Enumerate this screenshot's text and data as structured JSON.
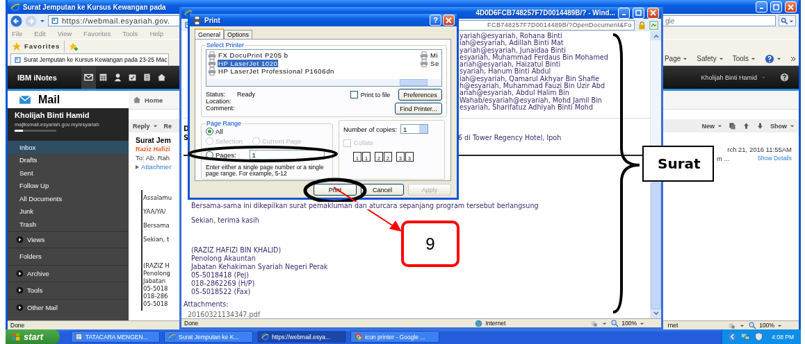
{
  "background_window": {
    "title": "Surat Jemputan ke Kursus Kewangan pada",
    "address": "https://webmail.esyariah.gov.",
    "menu": [
      "File",
      "Edit",
      "View",
      "Favorites",
      "Tools",
      "Help"
    ],
    "favorites": "Favorites",
    "tab": "Surat Jemputan ke Kursus Kewangan pada 23-25 Mac",
    "search_value": "gle",
    "commands": [
      "Page",
      "Safety",
      "Tools"
    ],
    "app": {
      "brand": "IBM iNotes",
      "user_menu": "Kholijah Binti Hamid",
      "title": "Mail",
      "home": "Home",
      "user_name": "Kholijah Binti Hamid",
      "user_address": "majlksmail.esyariah.gov.my/esyariah",
      "nav": [
        {
          "label": "Inbox",
          "kind": "item",
          "selected": true
        },
        {
          "label": "Drafts",
          "kind": "item",
          "selected": false
        },
        {
          "label": "Sent",
          "kind": "item",
          "selected": false
        },
        {
          "label": "Follow Up",
          "kind": "item",
          "selected": false
        },
        {
          "label": "All Documents",
          "kind": "item",
          "selected": false
        },
        {
          "label": "Junk",
          "kind": "item",
          "selected": false
        },
        {
          "label": "Trash",
          "kind": "item",
          "selected": false
        },
        {
          "label": "Views",
          "kind": "section",
          "selected": false
        },
        {
          "label": "Folders",
          "kind": "heading",
          "selected": false
        },
        {
          "label": "Archive",
          "kind": "section",
          "selected": false
        },
        {
          "label": "Tools",
          "kind": "section",
          "selected": false
        },
        {
          "label": "Other Mail",
          "kind": "section",
          "selected": false
        }
      ],
      "toolbar_left": [
        "Reply",
        "Re"
      ],
      "toolbar_right": [
        "New",
        "Show"
      ],
      "subject": "Surat Jem",
      "sender": "Raziz Hafizi",
      "to": "To: Ab. Rah",
      "attachments_toggle": "Attachmer",
      "date": "rch 21, 2016 11:55AM",
      "recipients_more": "m ...",
      "show_details": "Show Details",
      "body": [
        "Assalamu",
        "YAA/YA/",
        "Bersama",
        "Sekian, t"
      ],
      "signature": [
        "(RAZIZ H",
        "Penolong",
        "Jabatan",
        "05-5018",
        "018-286",
        "05-5018"
      ]
    },
    "status": "Done",
    "zone": "rnet",
    "zoom": "100%"
  },
  "popup_window": {
    "title": "4D0D6FCB748257F7D0014489B/? - Wind...",
    "address": "FCB748257F7D0014489B/?OpenDocument&Fo",
    "recipients": [
      "yariah@esyariah, Rohana Binti",
      "iah@esyariah, Adillah Binti Mat",
      "yariah@esyariah, Junaidaa Binti",
      "esyariah, Muhammad Ferdaus Bin Mohamed",
      "ariah@esyariah, Haizatul Binti",
      "syariah, Hanum Binti Abdul",
      "iah@esyariah, Qamarul Akhyar Bin Shafie",
      "h@esyariah, Muhammad Fauzi Bin Uzir Abd",
      "ariah@esyariah, Abdul Halim Bin",
      "Wahab/esyariah@esyariah, Mohd Jamil Bin",
      "esyariah, Sharifatuz Adhiyah Binti Mohd"
    ],
    "header_letters": [
      "D",
      "S"
    ],
    "subject_tail": "6 di Tower Regency Hotel, Ipoh",
    "body": [
      "Bersama-sama ini dikepilkan surat pemakluman dan aturcara sepanjang program tersebut berlangsung",
      "Sekian, terima kasih"
    ],
    "signature": [
      "(RAZIZ HAFIZI BIN KHALID)",
      "Penolong Akauntan",
      "Jabatan Kehakiman Syariah Negeri Perak",
      "05-5018418 (Pej)",
      "018-2862269 (H/P)",
      "05-5018522 (Fax)"
    ],
    "attachments_label": "Attachments:",
    "attachment": "20160321134347.pdf",
    "status": "Done",
    "zone": "Internet",
    "zoom": "100%"
  },
  "print_dialog": {
    "title": "Print",
    "help_label": "?",
    "tabs": [
      {
        "label": "General",
        "selected": true
      },
      {
        "label": "Options",
        "selected": false
      }
    ],
    "select_printer": "Select Printer",
    "printers": [
      {
        "name": "FX DocuPrint P205 b",
        "selected": false
      },
      {
        "name": "HP LaserJet 1020",
        "selected": true
      },
      {
        "name": "HP LaserJet Professional P1606dn",
        "selected": false
      },
      {
        "name": "Mi",
        "selected": false
      },
      {
        "name": "Se",
        "selected": false
      }
    ],
    "status_label": "Status:",
    "status_value": "Ready",
    "location_label": "Location:",
    "comment_label": "Comment:",
    "print_to_file": {
      "label": "Print to file",
      "checked": false
    },
    "preferences": "Preferences",
    "find_printer": "Find Printer...",
    "page_range": "Page Range",
    "ranges": [
      {
        "label": "All",
        "selected": true,
        "disabled": false
      },
      {
        "label": "Selection",
        "selected": false,
        "disabled": true
      },
      {
        "label": "Current Page",
        "selected": false,
        "disabled": true
      },
      {
        "label": "Pages:",
        "selected": false,
        "disabled": false
      }
    ],
    "pages_value": "1",
    "hint": "Enter either a single page number or a single page range.  For example, 5-12",
    "copies_label": "Number of copies:",
    "copies_value": "1",
    "collate": {
      "label": "Collate",
      "checked": false,
      "disabled": true
    },
    "collate_pages": [
      "1",
      "1",
      "2",
      "2",
      "3",
      "3"
    ],
    "buttons": [
      {
        "label": "Print",
        "disabled": false
      },
      {
        "label": "Cancel",
        "disabled": false
      },
      {
        "label": "Apply",
        "disabled": true
      }
    ]
  },
  "taskbar": {
    "start": "start",
    "tasks": [
      {
        "label": "TATACARA MENGEN...",
        "kind": "document",
        "selected": false
      },
      {
        "label": "Surat Jemputan ke K...",
        "kind": "browser",
        "selected": false
      },
      {
        "label": "https://webmail.esya...",
        "kind": "browser",
        "selected": true
      },
      {
        "label": "icon printer - Google ...",
        "kind": "chrome",
        "selected": false
      }
    ],
    "clock": "4:08 PM"
  },
  "annotations": {
    "step": "9",
    "label": "Surat"
  }
}
